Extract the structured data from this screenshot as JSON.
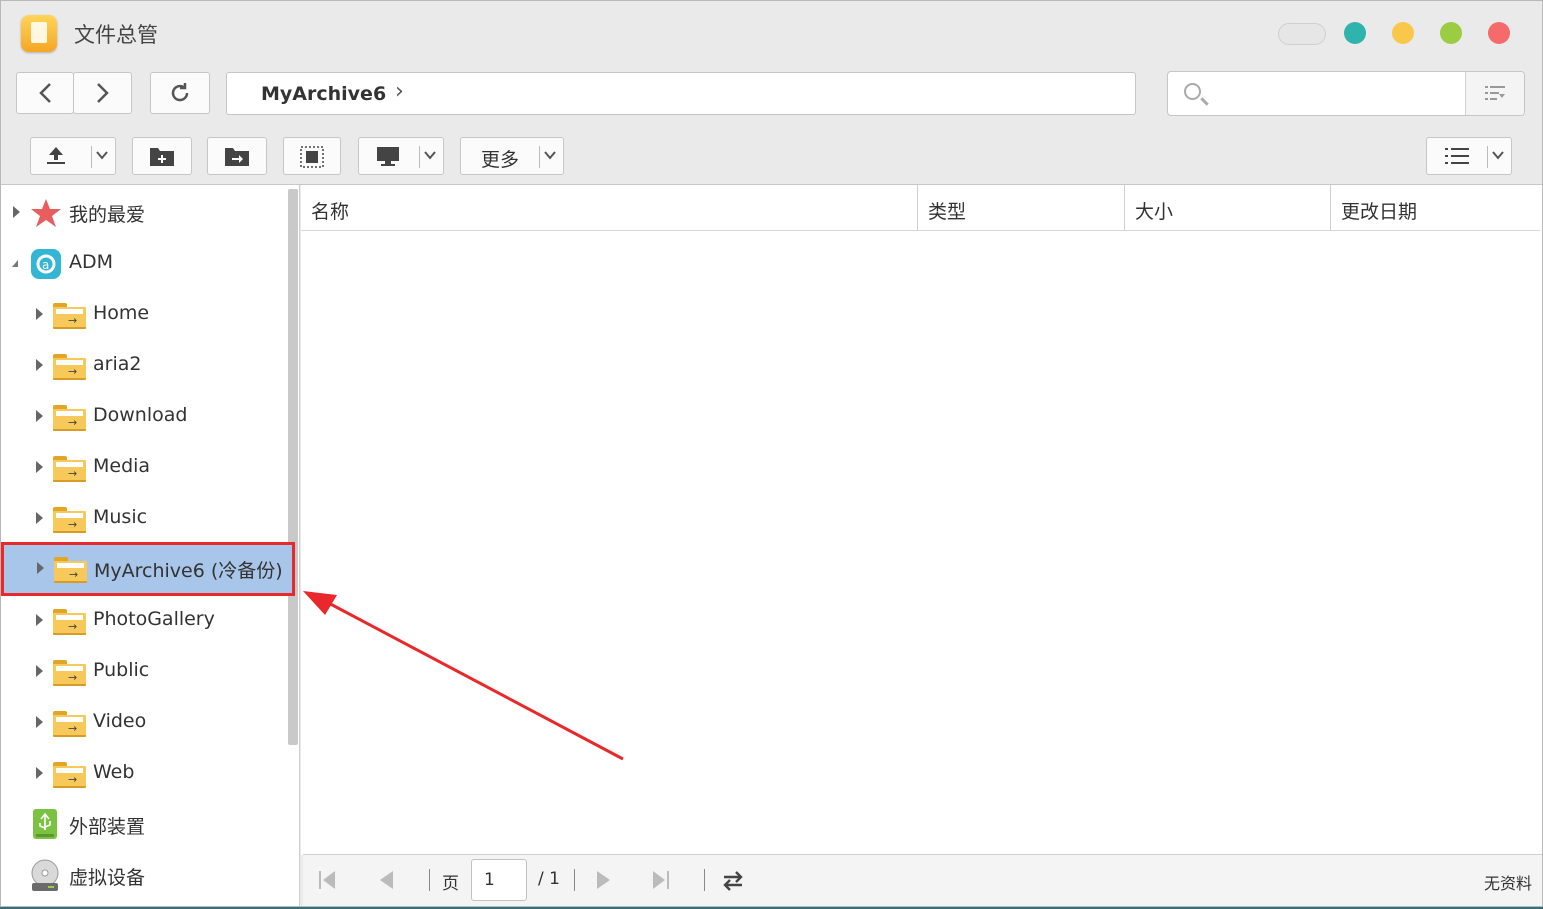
{
  "window": {
    "title": "文件总管"
  },
  "nav": {
    "path": "MyArchive6",
    "search_placeholder": ""
  },
  "toolbar": {
    "more_label": "更多"
  },
  "sidebar": {
    "favorites": "我的最爱",
    "root": "ADM",
    "folders": [
      {
        "label": "Home"
      },
      {
        "label": "aria2"
      },
      {
        "label": "Download"
      },
      {
        "label": "Media"
      },
      {
        "label": "Music"
      },
      {
        "label": "MyArchive6 (冷备份)",
        "selected": true
      },
      {
        "label": "PhotoGallery"
      },
      {
        "label": "Public"
      },
      {
        "label": "Video"
      },
      {
        "label": "Web"
      }
    ],
    "external": "外部装置",
    "virtual": "虚拟设备"
  },
  "table": {
    "columns": [
      "名称",
      "类型",
      "大小",
      "更改日期"
    ],
    "rows": []
  },
  "pager": {
    "page_label": "页",
    "page_value": "1",
    "total": "/ 1",
    "status": "无资料"
  },
  "colors": {
    "selection": "#a8c6ea",
    "highlight_box": "#e8282b",
    "annotation_arrow": "#e8282b"
  },
  "icons": [
    "back-icon",
    "forward-icon",
    "refresh-icon",
    "search-icon",
    "upload-icon",
    "new-folder-icon",
    "move-icon",
    "select-icon",
    "monitor-icon",
    "list-view-icon",
    "star-icon",
    "adm-icon",
    "usb-icon",
    "disc-icon"
  ]
}
